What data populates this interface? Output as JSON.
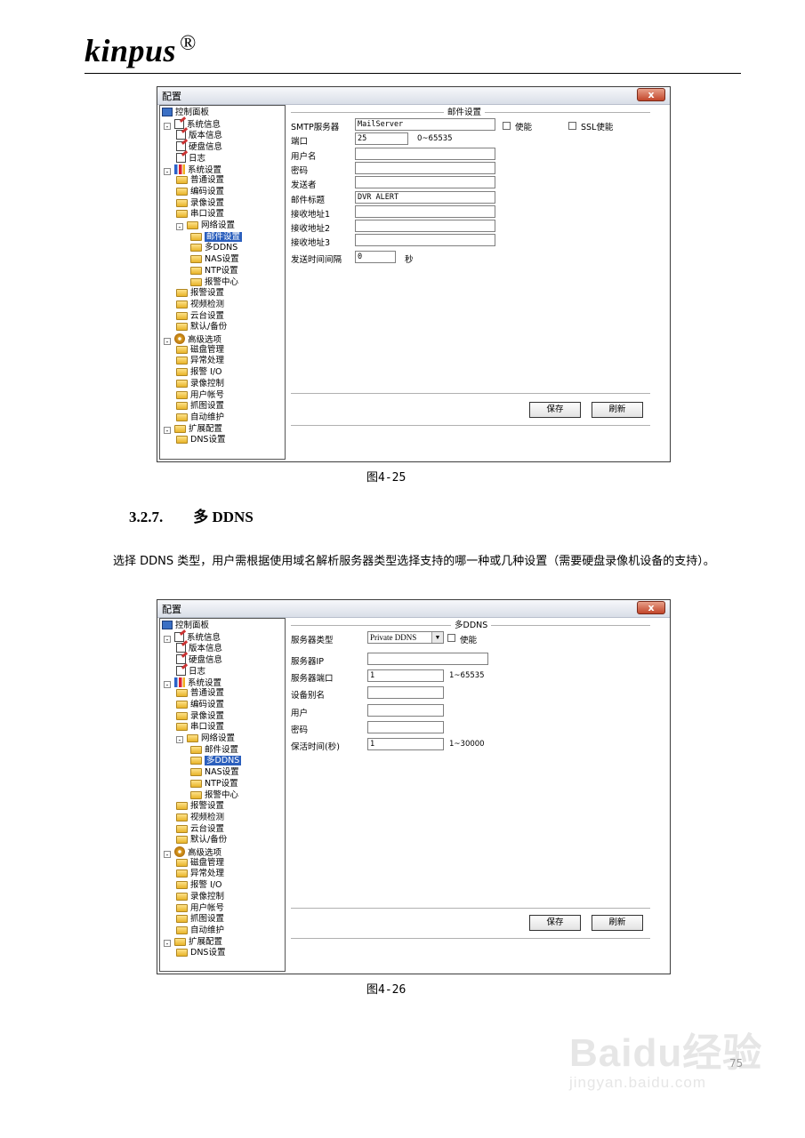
{
  "header": {
    "logo": "kinpus",
    "registered": "®"
  },
  "tree_items": [
    {
      "label": "控制面板",
      "level": 0,
      "icon": "computer-icon",
      "expander": ""
    },
    {
      "label": "系统信息",
      "level": 1,
      "icon": "document-icon",
      "expander": "⊟"
    },
    {
      "label": "版本信息",
      "level": 2,
      "icon": "document-icon",
      "expander": ""
    },
    {
      "label": "硬盘信息",
      "level": 2,
      "icon": "document-icon",
      "expander": ""
    },
    {
      "label": "日志",
      "level": 2,
      "icon": "document-icon",
      "expander": ""
    },
    {
      "label": "系统设置",
      "level": 1,
      "icon": "settings-bars-icon",
      "expander": "⊟"
    },
    {
      "label": "普通设置",
      "level": 2,
      "icon": "folder-icon",
      "expander": ""
    },
    {
      "label": "编码设置",
      "level": 2,
      "icon": "folder-icon",
      "expander": ""
    },
    {
      "label": "录像设置",
      "level": 2,
      "icon": "folder-icon",
      "expander": ""
    },
    {
      "label": "串口设置",
      "level": 2,
      "icon": "folder-icon",
      "expander": ""
    },
    {
      "label": "网络设置",
      "level": 2,
      "icon": "folder-icon",
      "expander": "⊟"
    },
    {
      "label": "邮件设置",
      "level": 3,
      "icon": "folder-icon",
      "expander": ""
    },
    {
      "label": "多DDNS",
      "level": 3,
      "icon": "folder-icon",
      "expander": ""
    },
    {
      "label": "NAS设置",
      "level": 3,
      "icon": "folder-icon",
      "expander": ""
    },
    {
      "label": "NTP设置",
      "level": 3,
      "icon": "folder-icon",
      "expander": ""
    },
    {
      "label": "报警中心",
      "level": 3,
      "icon": "folder-icon",
      "expander": ""
    },
    {
      "label": "报警设置",
      "level": 2,
      "icon": "folder-icon",
      "expander": ""
    },
    {
      "label": "视频检测",
      "level": 2,
      "icon": "folder-icon",
      "expander": ""
    },
    {
      "label": "云台设置",
      "level": 2,
      "icon": "folder-icon",
      "expander": ""
    },
    {
      "label": "默认/备份",
      "level": 2,
      "icon": "folder-icon",
      "expander": ""
    },
    {
      "label": "高级选项",
      "level": 1,
      "icon": "gear-icon",
      "expander": "⊟"
    },
    {
      "label": "磁盘管理",
      "level": 2,
      "icon": "folder-icon",
      "expander": ""
    },
    {
      "label": "异常处理",
      "level": 2,
      "icon": "folder-icon",
      "expander": ""
    },
    {
      "label": "报警 I/O",
      "level": 2,
      "icon": "folder-icon",
      "expander": ""
    },
    {
      "label": "录像控制",
      "level": 2,
      "icon": "folder-icon",
      "expander": ""
    },
    {
      "label": "用户帐号",
      "level": 2,
      "icon": "folder-icon",
      "expander": ""
    },
    {
      "label": "抓图设置",
      "level": 2,
      "icon": "folder-icon",
      "expander": ""
    },
    {
      "label": "自动维护",
      "level": 2,
      "icon": "folder-icon",
      "expander": ""
    },
    {
      "label": "扩展配置",
      "level": 1,
      "icon": "folder-icon",
      "expander": "⊟"
    },
    {
      "label": "DNS设置",
      "level": 2,
      "icon": "folder-icon",
      "expander": ""
    }
  ],
  "window1": {
    "title": "配置",
    "close": "x",
    "selected": "邮件设置",
    "group_title": "邮件设置",
    "rows": [
      {
        "label": "SMTP服务器",
        "value": "MailServer"
      },
      {
        "label": "端口",
        "value": "25",
        "hint": "0~65535"
      },
      {
        "label": "用户名",
        "value": ""
      },
      {
        "label": "密码",
        "value": ""
      },
      {
        "label": "发送者",
        "value": ""
      },
      {
        "label": "邮件标题",
        "value": "DVR ALERT"
      },
      {
        "label": "接收地址1",
        "value": ""
      },
      {
        "label": "接收地址2",
        "value": ""
      },
      {
        "label": "接收地址3",
        "value": ""
      }
    ],
    "interval_label": "发送时间间隔",
    "interval_value": "0",
    "interval_unit": "秒",
    "enable_label": "使能",
    "ssl_label": "SSL使能",
    "save": "保存",
    "refresh": "刷新"
  },
  "caption1": "图4-25",
  "section": {
    "number": "3.2.7.",
    "title": "多 DDNS"
  },
  "body_text": "选择 DDNS 类型，用户需根据使用域名解析服务器类型选择支持的哪一种或几种设置（需要硬盘录像机设备的支持）。",
  "window2": {
    "title": "配置",
    "close": "x",
    "selected": "多DDNS",
    "group_title": "多DDNS",
    "server_type_label": "服务器类型",
    "server_type_value": "Private DDNS",
    "enable_label": "使能",
    "rows": [
      {
        "label": "服务器IP",
        "value": ""
      },
      {
        "label": "服务器端口",
        "value": "1",
        "hint": "1~65535"
      },
      {
        "label": "设备别名",
        "value": ""
      },
      {
        "label": "用户",
        "value": ""
      },
      {
        "label": "密码",
        "value": ""
      },
      {
        "label": "保活时间(秒)",
        "value": "1",
        "hint": "1~30000"
      }
    ],
    "save": "保存",
    "refresh": "刷新"
  },
  "caption2": "图4-26",
  "watermark": {
    "line1": "Baidu经验",
    "line2": "jingyan.baidu.com"
  },
  "page_number": "75"
}
